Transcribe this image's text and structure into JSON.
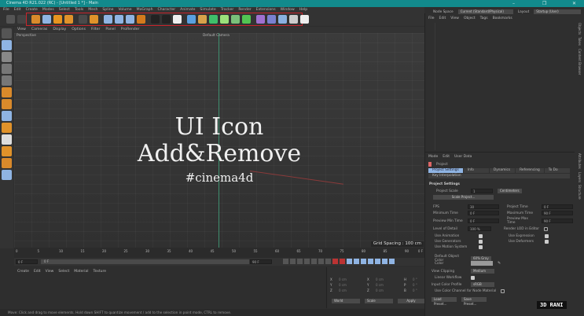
{
  "window": {
    "title": "Cinema 4D R21.022 (RC) - [Untitled 1 *] - Main",
    "controls": [
      "–",
      "❐",
      "✕"
    ]
  },
  "menu": [
    "File",
    "Edit",
    "Create",
    "Modes",
    "Select",
    "Tools",
    "Mesh",
    "Spline",
    "Volume",
    "MoGraph",
    "Character",
    "Animate",
    "Simulate",
    "Tracker",
    "Render",
    "Extensions",
    "Window",
    "Help"
  ],
  "toolbar": {
    "icons": [
      {
        "name": "undo-icon",
        "color": "#555"
      },
      {
        "name": "redo-icon",
        "color": "#444"
      },
      {
        "name": "live-selection-icon",
        "color": "#d98a2b"
      },
      {
        "name": "move-icon",
        "color": "#8fb4e3"
      },
      {
        "name": "scale-icon",
        "color": "#e8941f"
      },
      {
        "name": "rotate-icon",
        "color": "#e0922a"
      },
      {
        "name": "recent-tools-icon",
        "color": "#4a4a4a"
      },
      {
        "name": "coordinate-system-icon",
        "color": "#e0922a"
      },
      {
        "name": "x-axis-icon",
        "color": "#8fb4e3"
      },
      {
        "name": "y-axis-icon",
        "color": "#8fb4e3"
      },
      {
        "name": "z-axis-icon",
        "color": "#8fb4e3"
      },
      {
        "name": "world-coordinates-icon",
        "color": "#d47a1c"
      },
      {
        "name": "render-view-icon",
        "color": "#222"
      },
      {
        "name": "render-picture-viewer-icon",
        "color": "#222"
      },
      {
        "name": "render-settings-icon",
        "color": "#eee"
      },
      {
        "name": "cube-icon",
        "color": "#5aa0e0"
      },
      {
        "name": "pen-icon",
        "color": "#d8a24a"
      },
      {
        "name": "subdivision-icon",
        "color": "#3fbf6a"
      },
      {
        "name": "generator-icon",
        "color": "#9be07a"
      },
      {
        "name": "cloner-icon",
        "color": "#7ac07a"
      },
      {
        "name": "mograph-icon",
        "color": "#52c452"
      },
      {
        "name": "deformer-icon",
        "color": "#a070d0"
      },
      {
        "name": "field-icon",
        "color": "#7a80d0"
      },
      {
        "name": "environment-icon",
        "color": "#8ab0e0"
      },
      {
        "name": "camera-icon",
        "color": "#ccc"
      },
      {
        "name": "light-icon",
        "color": "#eee"
      }
    ]
  },
  "top_right": {
    "node_space_label": "Node Space",
    "node_space_value": "Current (Standard/Physical)",
    "layout_label": "Layout",
    "layout_value": "Startup (User)"
  },
  "viewport": {
    "menu": [
      "View",
      "Cameras",
      "Display",
      "Options",
      "Filter",
      "Panel",
      "ProRender"
    ],
    "view_name": "Perspective",
    "camera": "Default Camera",
    "grid_spacing": "Grid Spacing : 100 cm",
    "overlay": {
      "line1": "UI Icon",
      "line2": "Add&Remove",
      "line3": "#cinema4d"
    }
  },
  "left_palette": [
    "make-editable-icon",
    "model-mode-icon",
    "texture-mode-icon",
    "point-mode-icon",
    "edge-mode-icon",
    "polygon-mode-icon",
    "axis-icon",
    "snap-icon",
    "snap-settings-icon",
    "workplane-icon",
    "solo-icon",
    "lock-workplane-icon",
    "grid-icon"
  ],
  "object_manager": {
    "menu": [
      "File",
      "Edit",
      "View",
      "Object",
      "Tags",
      "Bookmarks"
    ],
    "tabs": [
      "Objects",
      "Takes",
      "Content Browser"
    ]
  },
  "attributes": {
    "menu": [
      "Mode",
      "Edit",
      "User Data"
    ],
    "object": "Project",
    "vtabs": [
      "Attributes",
      "Layers",
      "Structure"
    ],
    "tabs": [
      "Project Settings",
      "Info",
      "Dynamics",
      "Referencing",
      "To Do",
      "Key Interpolation"
    ],
    "section": "Project Settings",
    "project_scale_label": "Project Scale",
    "project_scale": "1",
    "project_scale_unit": "Centimeters",
    "scale_project_btn": "Scale Project...",
    "fields": [
      {
        "l": "FPS",
        "v": "30",
        "l2": "Project Time",
        "v2": "0 F"
      },
      {
        "l": "Minimum Time",
        "v": "0 F",
        "l2": "Maximum Time",
        "v2": "90 F"
      },
      {
        "l": "Preview Min Time",
        "v": "0 F",
        "l2": "Preview Max Time",
        "v2": "90 F"
      }
    ],
    "lod_label": "Level of Detail",
    "lod": "100 %",
    "render_lod_label": "Render LOD in Editor",
    "checks": [
      {
        "l": "Use Animation",
        "l2": "Use Expression"
      },
      {
        "l": "Use Generators",
        "l2": "Use Deformers"
      },
      {
        "l": "Use Motion System",
        "l2": ""
      }
    ],
    "default_color_label": "Default Object Color",
    "default_color": "60% Gray",
    "color_label": "Color",
    "color_value": "#9a9a9a",
    "view_clipping_label": "View Clipping",
    "view_clipping": "Medium",
    "linear_workflow_label": "Linear Workflow",
    "input_color_label": "Input Color Profile",
    "input_color": "sRGB",
    "node_material_label": "Use Color Channel for Node Material",
    "load_preset": "Load Preset...",
    "save_preset": "Save Preset..."
  },
  "timeline": {
    "ticks": [
      "0",
      "5",
      "10",
      "15",
      "20",
      "25",
      "30",
      "35",
      "40",
      "45",
      "50",
      "55",
      "60",
      "65",
      "70",
      "75",
      "80",
      "85",
      "90"
    ],
    "end_label": "0 F",
    "start": "0 F",
    "current": "0 F",
    "range_end": "90 F",
    "end": "90 F"
  },
  "material_manager": {
    "menu": [
      "Create",
      "Edit",
      "View",
      "Select",
      "Material",
      "Texture"
    ]
  },
  "coordinates": {
    "rows": [
      {
        "a": "X",
        "v": "0 cm",
        "b": "X",
        "w": "0 cm",
        "c": "H",
        "x": "0 °"
      },
      {
        "a": "Y",
        "v": "0 cm",
        "b": "Y",
        "w": "0 cm",
        "c": "P",
        "x": "0 °"
      },
      {
        "a": "Z",
        "v": "0 cm",
        "b": "Z",
        "w": "0 cm",
        "c": "B",
        "x": "0 °"
      }
    ],
    "mode": "World",
    "size_mode": "Scale",
    "apply": "Apply"
  },
  "status": "Move: Click and drag to move elements. Hold down SHIFT to quantize movement / add to the selection in point mode, CTRL to remove.",
  "watermark": "3D RANI",
  "colors": {
    "titlebar": "#128a8c",
    "highlight": "#c9252c",
    "selected_tab": "#8fb4e3"
  }
}
